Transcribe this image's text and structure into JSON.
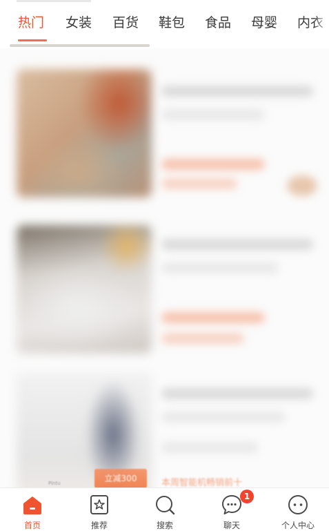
{
  "category_tabs": [
    {
      "label": "热门",
      "active": true
    },
    {
      "label": "女装",
      "active": false
    },
    {
      "label": "百货",
      "active": false
    },
    {
      "label": "鞋包",
      "active": false
    },
    {
      "label": "食品",
      "active": false
    },
    {
      "label": "母婴",
      "active": false
    },
    {
      "label": "内衣",
      "active": false
    }
  ],
  "feed": {
    "promo_button": "立减300",
    "promo_caption": "本周智能机畅销前十",
    "tiny_caption": "Pintu"
  },
  "bottom_nav": [
    {
      "label": "首页",
      "icon": "home-icon",
      "active": true
    },
    {
      "label": "推荐",
      "icon": "recommend-icon",
      "active": false
    },
    {
      "label": "搜索",
      "icon": "search-icon",
      "active": false
    },
    {
      "label": "聊天",
      "icon": "chat-icon",
      "active": false
    },
    {
      "label": "个人中心",
      "icon": "profile-icon",
      "active": false
    }
  ],
  "chat_badge_count": "1",
  "colors": {
    "accent": "#f0532f",
    "badge": "#f2432e"
  }
}
